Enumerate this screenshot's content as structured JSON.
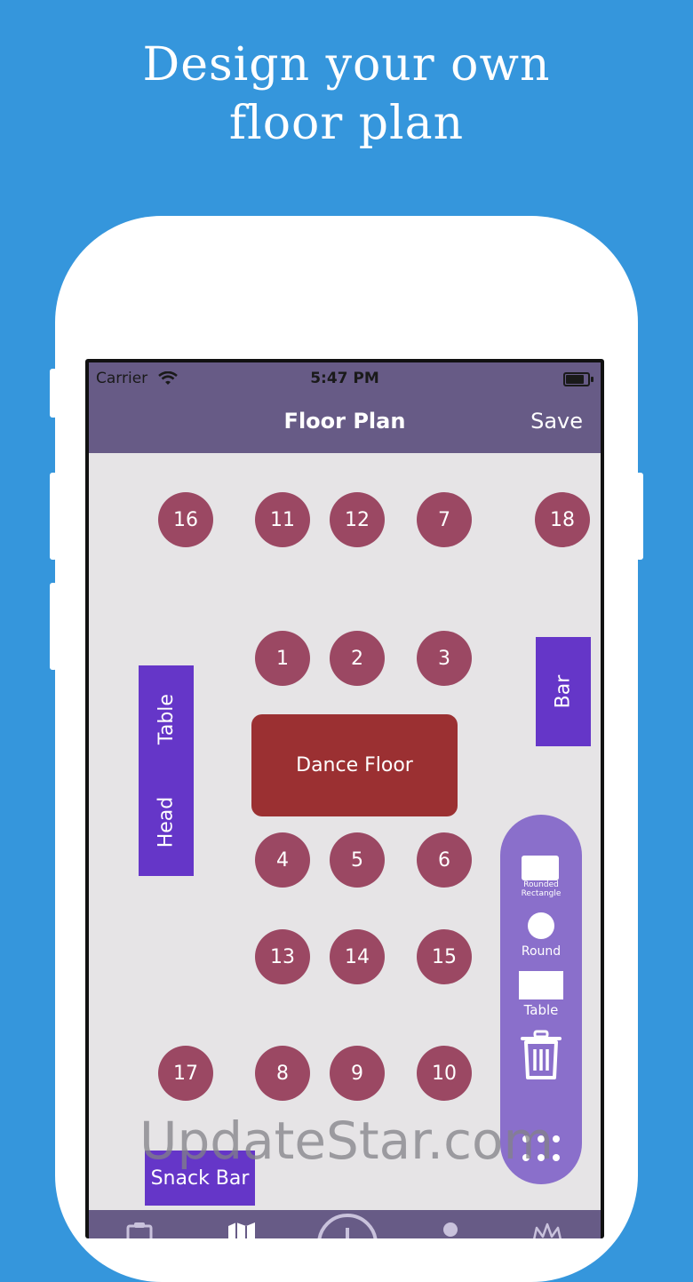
{
  "headline": {
    "line1": "Design your own",
    "line2": "floor plan"
  },
  "status_bar": {
    "carrier": "Carrier",
    "time": "5:47 PM"
  },
  "nav": {
    "title": "Floor Plan",
    "save_label": "Save"
  },
  "tables": [
    "16",
    "11",
    "12",
    "7",
    "18",
    "1",
    "2",
    "3",
    "4",
    "5",
    "6",
    "13",
    "14",
    "15",
    "17",
    "8",
    "9",
    "10"
  ],
  "rects": {
    "head_table_line1": "Table",
    "head_table_line2": "Head",
    "bar": "Bar",
    "snack_bar": "Snack Bar"
  },
  "dance_floor": "Dance Floor",
  "toolbox": {
    "rounded_rect_line1": "Rounded",
    "rounded_rect_line2": "Rectangle",
    "round": "Round",
    "table": "Table",
    "trash_icon": "trash-icon",
    "more_icon": "grid-dots-icon"
  },
  "watermark": "UpdateStar.com",
  "colors": {
    "background": "#3596dc",
    "navbar": "#675b86",
    "table_circle": "#9b4863",
    "rect": "#6536c8",
    "dance_floor": "#9b3032",
    "toolbox": "#8a6fcb"
  }
}
